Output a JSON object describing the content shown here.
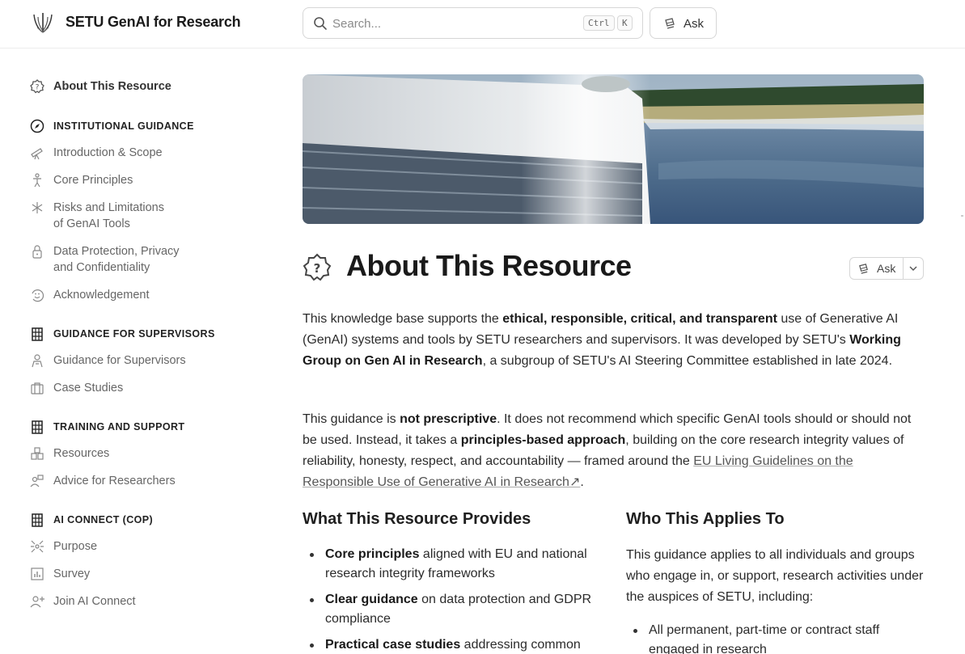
{
  "header": {
    "brand": "SETU GenAI for Research",
    "search_placeholder": "Search...",
    "kbd_ctrl": "Ctrl",
    "kbd_k": "K",
    "ask_label": "Ask"
  },
  "sidebar": {
    "about": "About This Resource",
    "sections": [
      {
        "title": "INSTITUTIONAL GUIDANCE"
      },
      {
        "title": "GUIDANCE FOR SUPERVISORS"
      },
      {
        "title": "TRAINING AND SUPPORT"
      },
      {
        "title": "AI CONNECT (COP)"
      }
    ],
    "items": {
      "intro": "Introduction & Scope",
      "core": "Core Principles",
      "risks_1": "Risks and Limitations",
      "risks_2": "of GenAI Tools",
      "data_1": "Data Protection, Privacy",
      "data_2": "and Confidentiality",
      "ack": "Acknowledgement",
      "supervisors": "Guidance for Supervisors",
      "cases": "Case Studies",
      "resources": "Resources",
      "advice": "Advice for Researchers",
      "purpose": "Purpose",
      "survey": "Survey",
      "join": "Join AI Connect"
    }
  },
  "main": {
    "title": "About This Resource",
    "ask_label": "Ask",
    "p1": {
      "a": "This knowledge base supports the ",
      "b": "ethical, responsible, critical, and transparent",
      "c": " use of Generative AI (GenAI) systems and tools by SETU researchers and supervisors. It was developed by SETU's ",
      "d": "Working Group on Gen AI in Research",
      "e": ", a subgroup of SETU's AI Steering Committee established in late 2024."
    },
    "p2": {
      "a": "This guidance is ",
      "b": "not prescriptive",
      "c": ". It does not recommend which specific GenAI tools should or should not be used. Instead, it takes a ",
      "d": "principles-based approach",
      "e": ", building on the core research integrity values of reliability, honesty, respect, and accountability — framed around the ",
      "link": "EU Living Guidelines on the Responsible Use of Generative AI in Research",
      "arrow": "↗",
      "f": "."
    },
    "provides_heading": "What This Resource Provides",
    "provides": [
      {
        "b": "Core principles",
        "t": " aligned with EU and national research integrity frameworks"
      },
      {
        "b": "Clear guidance",
        "t": " on data protection and GDPR compliance"
      },
      {
        "b": "Practical case studies",
        "t": " addressing common"
      }
    ],
    "applies_heading": "Who This Applies To",
    "applies_text": "This guidance applies to all individuals and groups who engage in, or support, research activities under the auspices of SETU, including:",
    "applies_list": [
      "All permanent, part-time or contract staff engaged in research"
    ]
  }
}
